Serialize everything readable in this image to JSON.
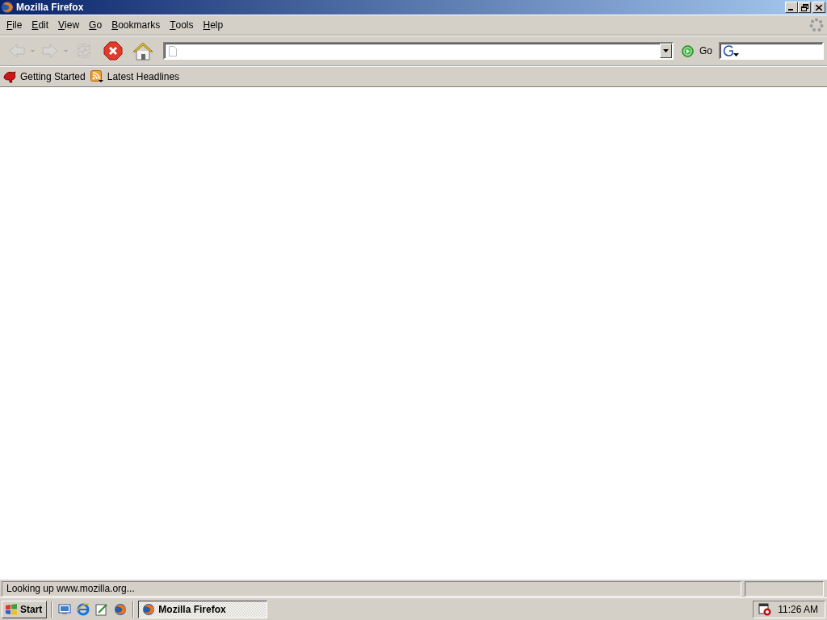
{
  "window": {
    "title": "Mozilla Firefox"
  },
  "menu": [
    {
      "key": "F",
      "rest": "ile"
    },
    {
      "key": "E",
      "rest": "dit"
    },
    {
      "key": "V",
      "rest": "iew"
    },
    {
      "key": "G",
      "rest": "o"
    },
    {
      "key": "B",
      "rest": "ookmarks"
    },
    {
      "key": "T",
      "rest": "ools"
    },
    {
      "key": "H",
      "rest": "elp"
    }
  ],
  "toolbar": [
    {
      "kind": "back",
      "disabled": true
    },
    {
      "kind": "forward",
      "disabled": true
    },
    {
      "kind": "reload",
      "disabled": true
    },
    {
      "kind": "stop",
      "disabled": false
    },
    {
      "kind": "home",
      "disabled": false
    }
  ],
  "go_button": {
    "label": "Go"
  },
  "bookmarks": [
    {
      "kind": "bird",
      "label": "Getting Started"
    },
    {
      "kind": "feed",
      "label": "Latest Headlines"
    }
  ],
  "status_bar": {
    "text": "Looking up www.mozilla.org..."
  },
  "taskbar": {
    "start": "Start",
    "quick_launch": [
      {
        "kind": "desktop"
      },
      {
        "kind": "ie"
      },
      {
        "kind": "notepad"
      },
      {
        "kind": "firefox"
      }
    ],
    "tasks": [
      {
        "label": "Mozilla Firefox",
        "selected": true
      }
    ],
    "clock": "11:26 AM"
  }
}
